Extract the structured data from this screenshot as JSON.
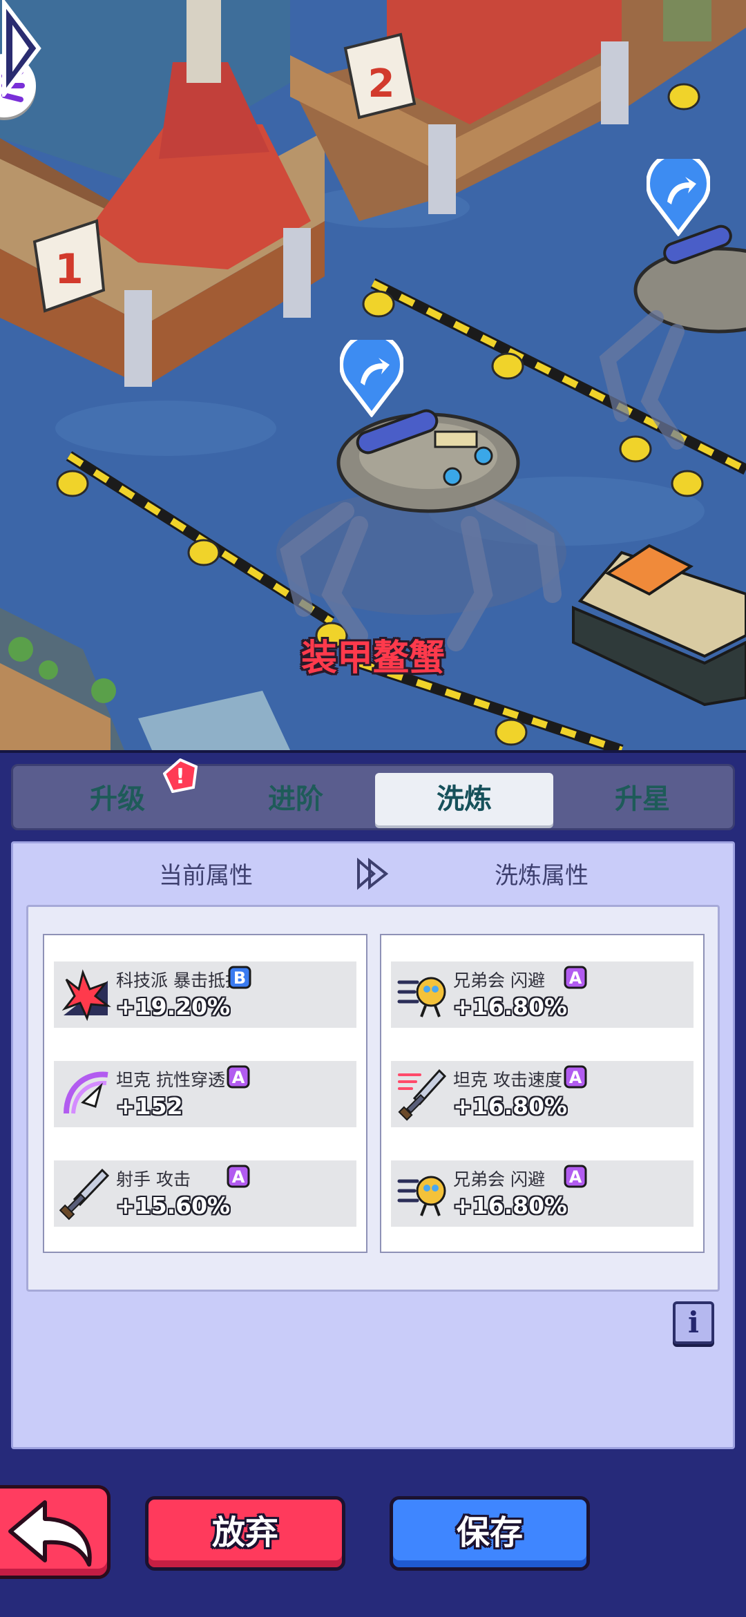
{
  "scene": {
    "monster_name": "装甲鳌蟹",
    "pier_numbers": [
      "1",
      "2"
    ]
  },
  "tabs": [
    {
      "label": "升级",
      "active": false
    },
    {
      "label": "进阶",
      "active": false
    },
    {
      "label": "洗炼",
      "active": true
    },
    {
      "label": "升星",
      "active": false
    }
  ],
  "notification_badge": "!",
  "columns": {
    "current_label": "当前属性",
    "refined_label": "洗炼属性"
  },
  "current_attributes": [
    {
      "name": "科技派 暴击抵抗",
      "grade": "B",
      "value": "+19.20%",
      "icon": "crit-burst-icon"
    },
    {
      "name": "坦克 抗性穿透",
      "grade": "A",
      "value": "+152",
      "icon": "pierce-spiral-icon"
    },
    {
      "name": "射手 攻击",
      "grade": "A",
      "value": "+15.60%",
      "icon": "sword-icon"
    }
  ],
  "refined_attributes": [
    {
      "name": "兄弟会 闪避",
      "grade": "A",
      "value": "+16.80%",
      "icon": "dodge-runner-icon"
    },
    {
      "name": "坦克 攻击速度",
      "grade": "A",
      "value": "+16.80%",
      "icon": "fast-sword-icon"
    },
    {
      "name": "兄弟会 闪避",
      "grade": "A",
      "value": "+16.80%",
      "icon": "dodge-runner-icon"
    }
  ],
  "info_label": "i",
  "buttons": {
    "discard": "放弃",
    "save": "保存"
  },
  "colors": {
    "grade_a": "#b25cf0",
    "grade_b": "#3a7bf0",
    "discard": "#ff3a5c",
    "save": "#3f86ff"
  }
}
